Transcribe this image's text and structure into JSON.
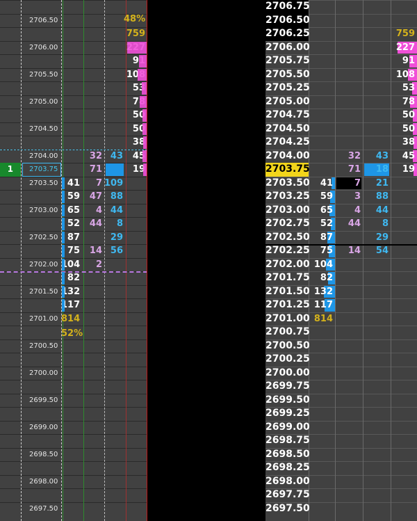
{
  "left_ladder": {
    "percent_top": "48%",
    "percent_bottom": "52%",
    "marker_qty": "1",
    "current_price": "2703.75",
    "price_labels": [
      "2706.50",
      "2706.00",
      "2705.50",
      "2705.00",
      "2704.50",
      "2704.00",
      "2703.75",
      "2703.50",
      "2703.00",
      "2702.50",
      "2702.00",
      "2701.50",
      "2701.00",
      "2700.50",
      "2700.00",
      "2699.50",
      "2699.00",
      "2698.50",
      "2698.00",
      "2697.50"
    ],
    "ask_volume": [
      {
        "row": 2,
        "val": "759",
        "color": "#d4b21c"
      },
      {
        "row": 3,
        "val": "227"
      },
      {
        "row": 4,
        "val": "91"
      },
      {
        "row": 5,
        "val": "108"
      },
      {
        "row": 6,
        "val": "53"
      },
      {
        "row": 7,
        "val": "78"
      },
      {
        "row": 8,
        "val": "50"
      },
      {
        "row": 9,
        "val": "50"
      },
      {
        "row": 10,
        "val": "38"
      },
      {
        "row": 11,
        "val": "45"
      },
      {
        "row": 12,
        "val": "19"
      }
    ],
    "bid_volume": [
      {
        "row": 13,
        "val": "41"
      },
      {
        "row": 14,
        "val": "59"
      },
      {
        "row": 15,
        "val": "65"
      },
      {
        "row": 16,
        "val": "52"
      },
      {
        "row": 17,
        "val": "87"
      },
      {
        "row": 18,
        "val": "75"
      },
      {
        "row": 19,
        "val": "104"
      },
      {
        "row": 20,
        "val": "82"
      },
      {
        "row": 21,
        "val": "132"
      },
      {
        "row": 22,
        "val": "117"
      },
      {
        "row": 23,
        "val": "814",
        "color": "#d4b21c"
      }
    ],
    "sell_trades": [
      {
        "row": 11,
        "val": "32"
      },
      {
        "row": 12,
        "val": "71"
      },
      {
        "row": 13,
        "val": "7"
      },
      {
        "row": 14,
        "val": "47"
      },
      {
        "row": 15,
        "val": "4"
      },
      {
        "row": 16,
        "val": "44"
      },
      {
        "row": 18,
        "val": "14"
      },
      {
        "row": 19,
        "val": "2"
      }
    ],
    "buy_trades": [
      {
        "row": 11,
        "val": "43"
      },
      {
        "row": 12,
        "val": "18"
      },
      {
        "row": 13,
        "val": "109"
      },
      {
        "row": 14,
        "val": "88"
      },
      {
        "row": 15,
        "val": "44"
      },
      {
        "row": 16,
        "val": "8"
      },
      {
        "row": 17,
        "val": "29"
      },
      {
        "row": 18,
        "val": "56"
      }
    ]
  },
  "right_ladder": {
    "prices": [
      "2706.75",
      "2706.50",
      "2706.25",
      "2706.00",
      "2705.75",
      "2705.50",
      "2705.25",
      "2705.00",
      "2704.75",
      "2704.50",
      "2704.25",
      "2704.00",
      "2703.75",
      "2703.50",
      "2703.25",
      "2703.00",
      "2702.75",
      "2702.50",
      "2702.25",
      "2702.00",
      "2701.75",
      "2701.50",
      "2701.25",
      "2701.00",
      "2700.75",
      "2700.50",
      "2700.25",
      "2700.00",
      "2699.75",
      "2699.50",
      "2699.25",
      "2699.00",
      "2698.75",
      "2698.50",
      "2698.25",
      "2698.00",
      "2697.75",
      "2697.50"
    ],
    "current_row": 12,
    "ask_volume": [
      {
        "row": 2,
        "val": "759",
        "color": "#d4b21c"
      },
      {
        "row": 3,
        "val": "227"
      },
      {
        "row": 4,
        "val": "91"
      },
      {
        "row": 5,
        "val": "108"
      },
      {
        "row": 6,
        "val": "53"
      },
      {
        "row": 7,
        "val": "78"
      },
      {
        "row": 8,
        "val": "50"
      },
      {
        "row": 9,
        "val": "50"
      },
      {
        "row": 10,
        "val": "38"
      },
      {
        "row": 11,
        "val": "45"
      },
      {
        "row": 12,
        "val": "19"
      }
    ],
    "bid_volume": [
      {
        "row": 13,
        "val": "41"
      },
      {
        "row": 14,
        "val": "59"
      },
      {
        "row": 15,
        "val": "65"
      },
      {
        "row": 16,
        "val": "52"
      },
      {
        "row": 17,
        "val": "87"
      },
      {
        "row": 18,
        "val": "75"
      },
      {
        "row": 19,
        "val": "104"
      },
      {
        "row": 20,
        "val": "82"
      },
      {
        "row": 21,
        "val": "132"
      },
      {
        "row": 22,
        "val": "117"
      },
      {
        "row": 23,
        "val": "814",
        "color": "#d4b21c"
      }
    ],
    "sell_trades": [
      {
        "row": 11,
        "val": "32"
      },
      {
        "row": 12,
        "val": "71"
      },
      {
        "row": 13,
        "val": "7"
      },
      {
        "row": 14,
        "val": "3"
      },
      {
        "row": 15,
        "val": "4"
      },
      {
        "row": 16,
        "val": "44"
      },
      {
        "row": 18,
        "val": "14"
      }
    ],
    "buy_trades": [
      {
        "row": 11,
        "val": "43"
      },
      {
        "row": 12,
        "val": "18"
      },
      {
        "row": 13,
        "val": "21"
      },
      {
        "row": 14,
        "val": "88"
      },
      {
        "row": 15,
        "val": "44"
      },
      {
        "row": 16,
        "val": "8"
      },
      {
        "row": 17,
        "val": "29"
      },
      {
        "row": 18,
        "val": "54"
      }
    ]
  },
  "colors": {
    "ask_bar": "#f04fd8",
    "bid_bar": "#1e96e6",
    "sell_text": "#d9a6e6",
    "buy_text": "#3fb8f0",
    "highlight": "#f2d51b"
  }
}
